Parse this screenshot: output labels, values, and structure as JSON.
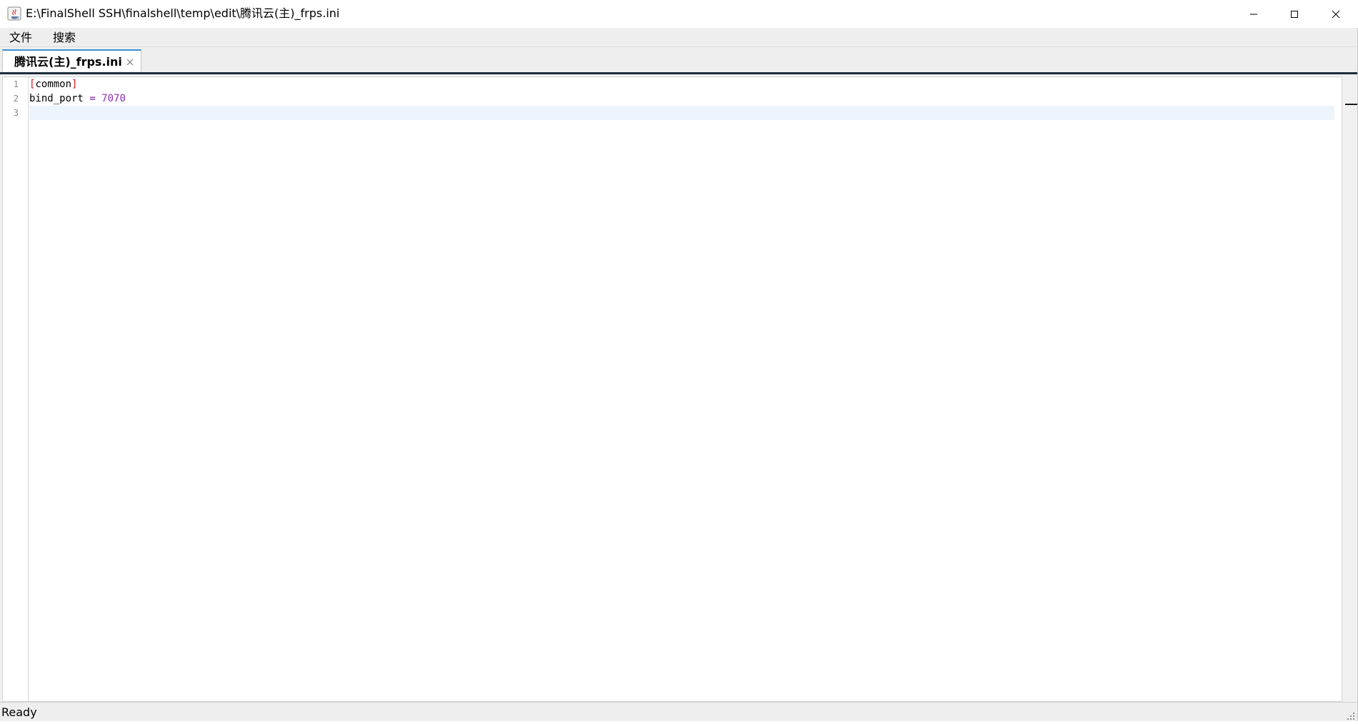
{
  "window": {
    "title": "E:\\FinalShell SSH\\finalshell\\temp\\edit\\腾讯云(主)_frps.ini"
  },
  "menu": {
    "file_label": "文件",
    "search_label": "搜索"
  },
  "tabs": [
    {
      "label": "腾讯云(主)_frps.ini",
      "active": true
    }
  ],
  "editor": {
    "line_numbers": [
      "1",
      "2",
      "3"
    ],
    "lines": [
      {
        "open_bracket": "[",
        "section": "common",
        "close_bracket": "]"
      },
      {
        "key": "bind_port",
        "operator": " = ",
        "value": "7070"
      },
      {
        "text": ""
      }
    ],
    "current_line": 3
  },
  "status": {
    "text": "Ready"
  },
  "colors": {
    "bracket": "#d81b1b",
    "number": "#8b2fb5",
    "tab_accent": "#3c8fd6",
    "current_line_highlight": "#eef4fc"
  }
}
